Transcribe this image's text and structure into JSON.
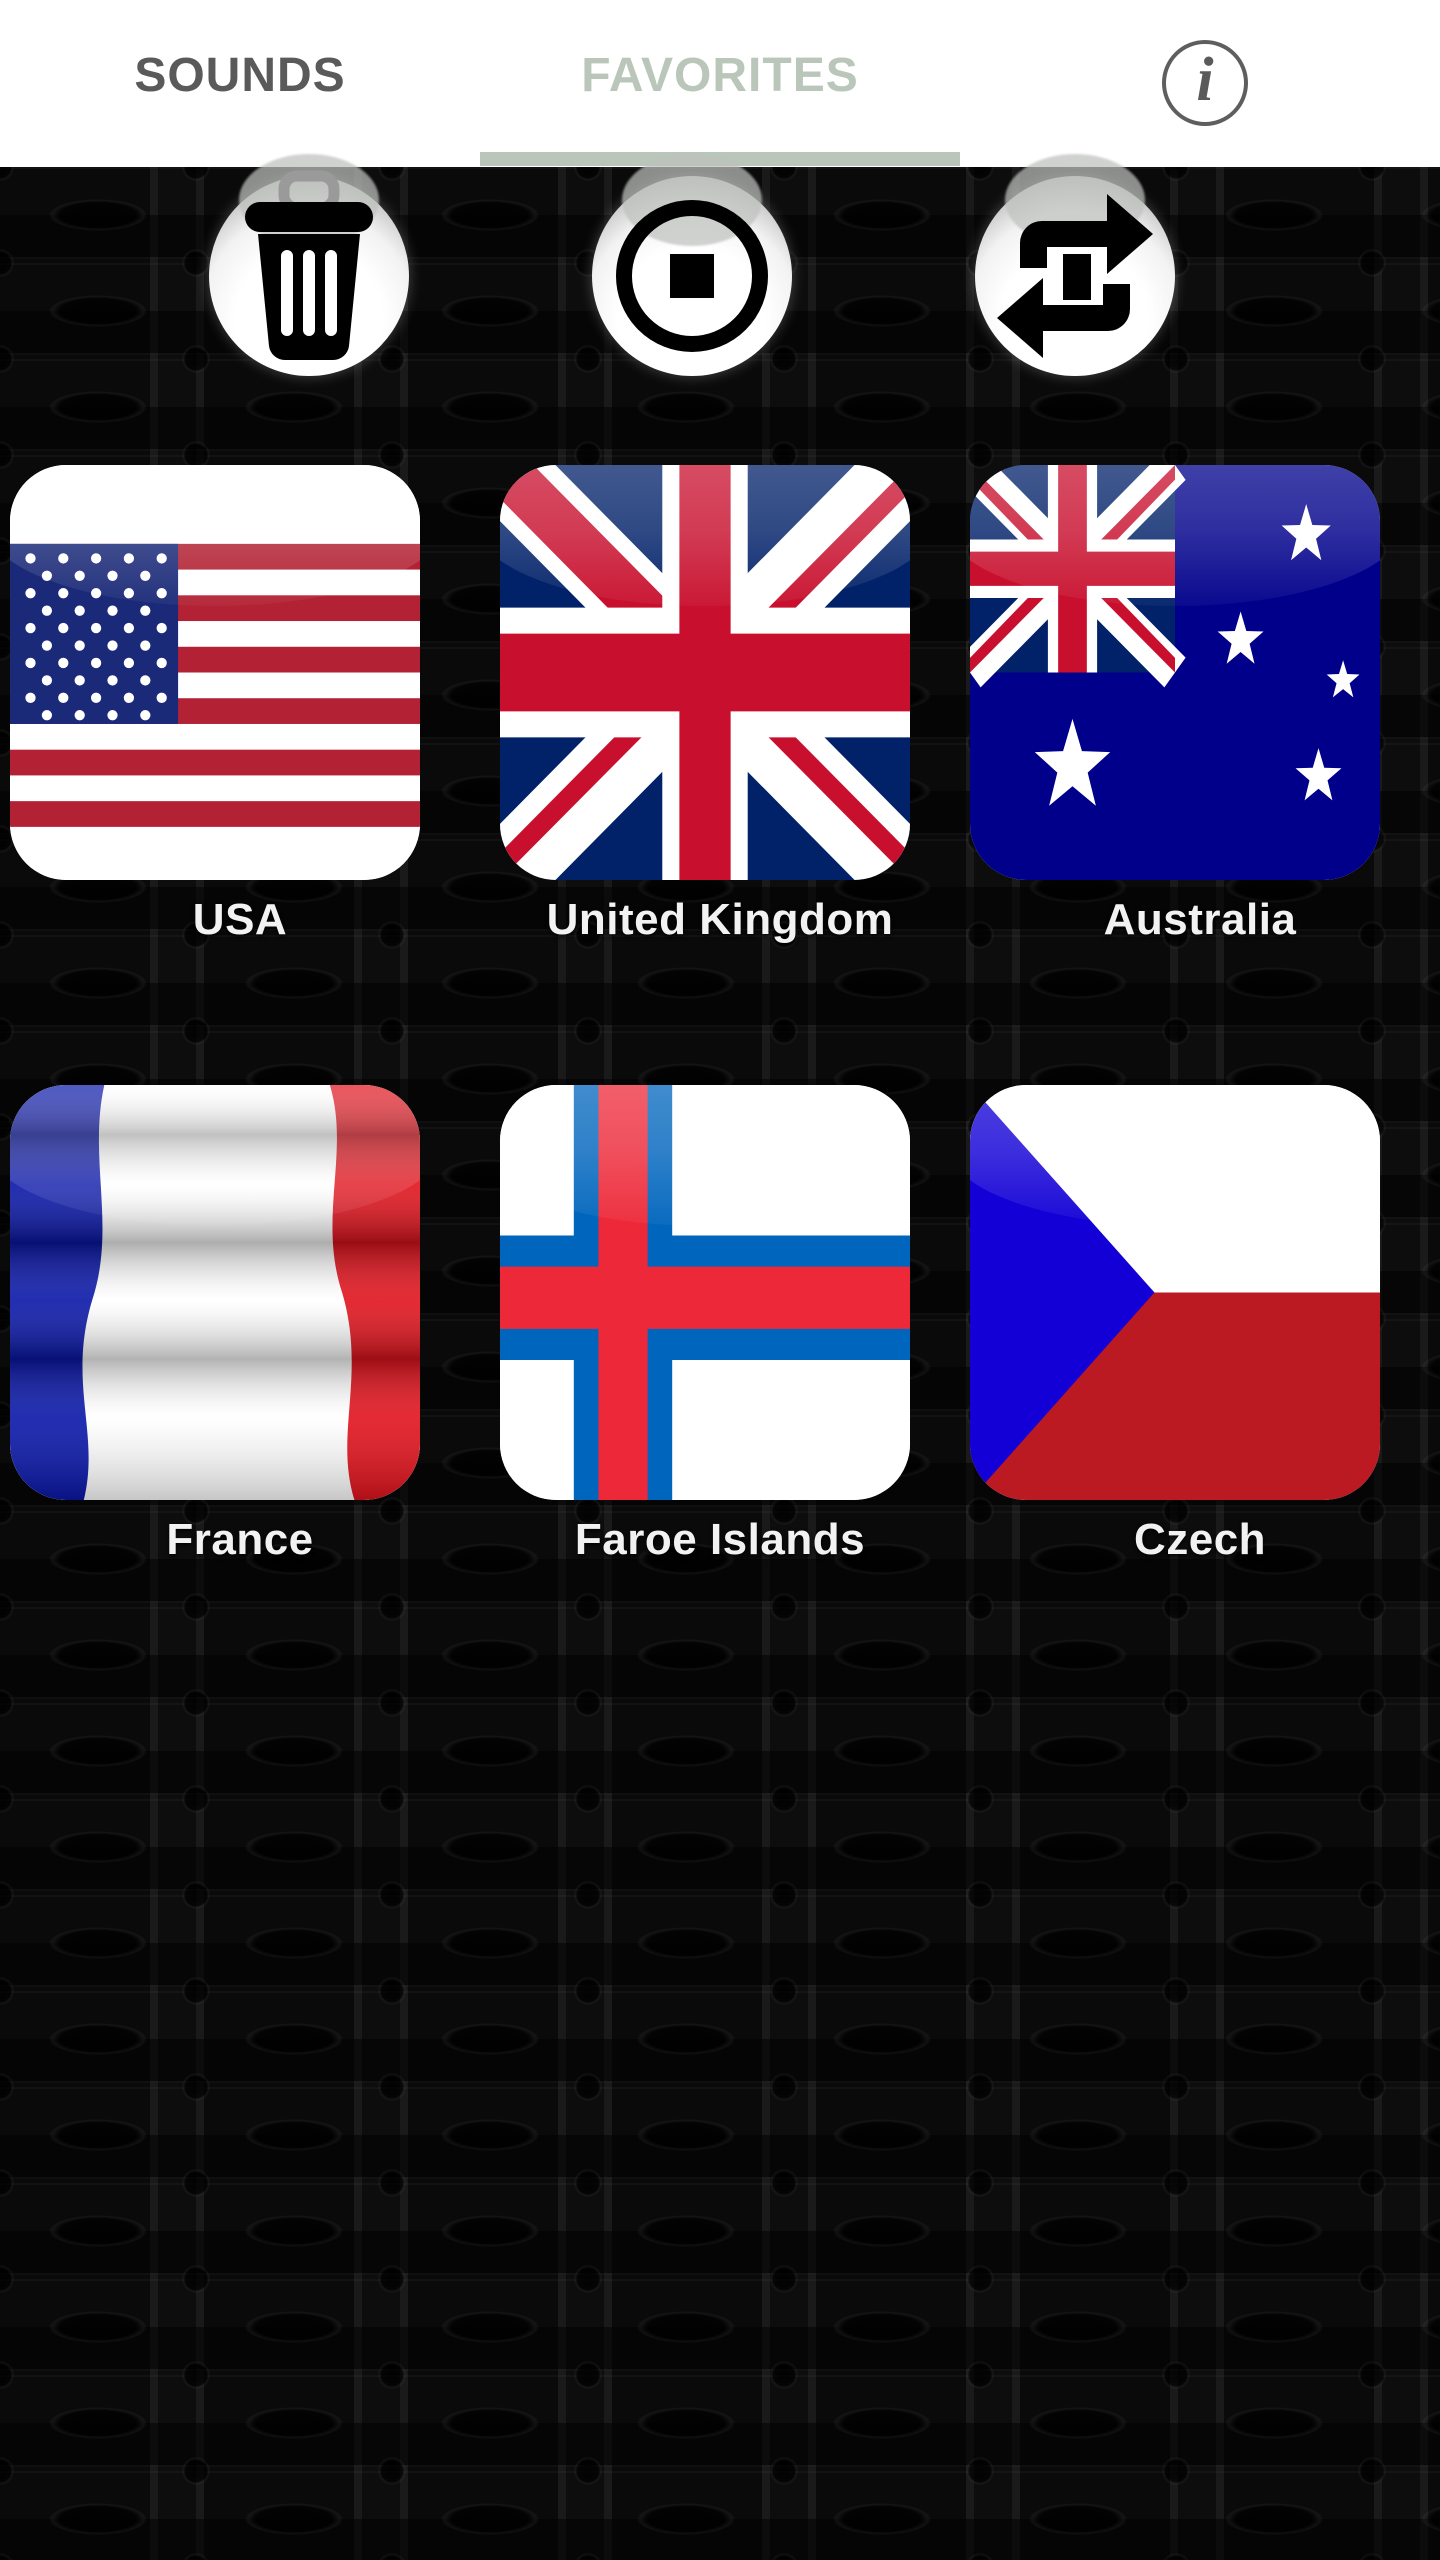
{
  "app": {
    "background_color": "#121212",
    "tab_accent_color": "#b9c6b9",
    "tab_inactive_color": "#5a5a5a"
  },
  "tabs": {
    "items": [
      {
        "id": "sounds",
        "label": "SOUNDS",
        "active": false
      },
      {
        "id": "favorites",
        "label": "FAVORITES",
        "active": true
      }
    ],
    "info_button": {
      "icon": "info-icon",
      "glyph": "i"
    }
  },
  "toolbar": {
    "buttons": [
      {
        "id": "delete",
        "icon": "trash-icon",
        "label": "Delete"
      },
      {
        "id": "stop",
        "icon": "stop-icon",
        "label": "Stop"
      },
      {
        "id": "repeat",
        "icon": "repeat-icon",
        "label": "Repeat"
      }
    ]
  },
  "favorites": {
    "columns": 3,
    "items": [
      {
        "id": "usa",
        "label": "USA",
        "flag": "us"
      },
      {
        "id": "united-kingdom",
        "label": "United Kingdom",
        "flag": "gb"
      },
      {
        "id": "australia",
        "label": "Australia",
        "flag": "au"
      },
      {
        "id": "france",
        "label": "France",
        "flag": "fr"
      },
      {
        "id": "faroe-islands",
        "label": "Faroe Islands",
        "flag": "fo"
      },
      {
        "id": "czech",
        "label": "Czech",
        "flag": "cz"
      }
    ]
  }
}
